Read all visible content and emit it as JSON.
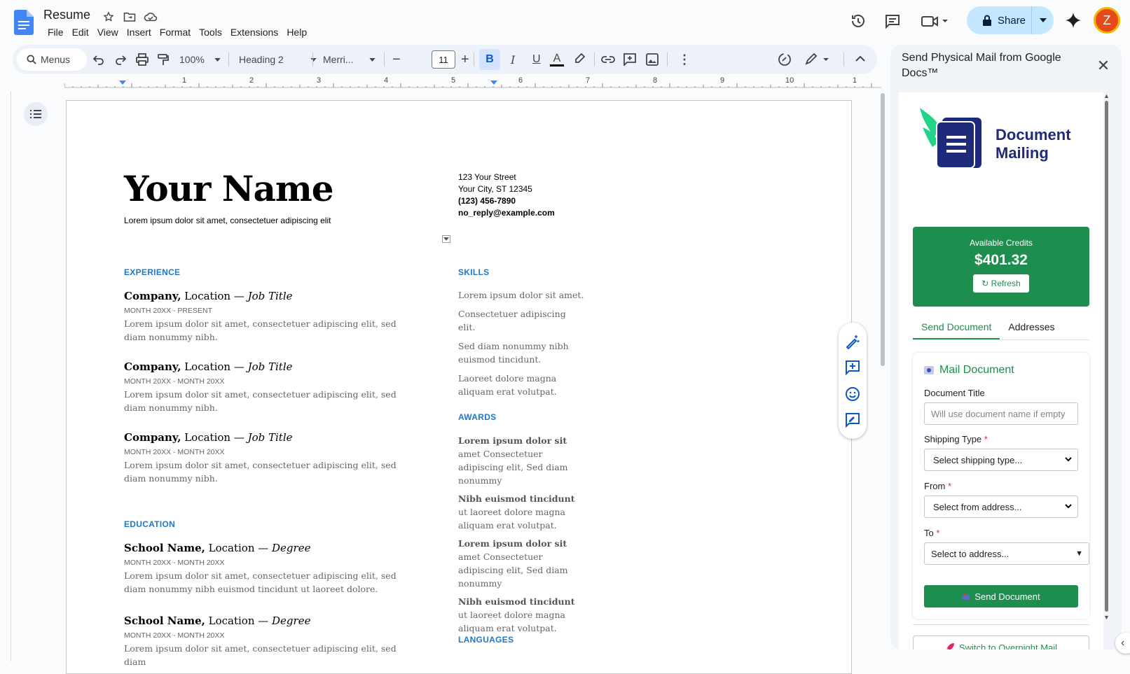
{
  "app": {
    "doc_title": "Resume",
    "menu": [
      "File",
      "Edit",
      "View",
      "Insert",
      "Format",
      "Tools",
      "Extensions",
      "Help"
    ],
    "share_label": "Share",
    "avatar_letter": "Z"
  },
  "toolbar": {
    "menus_label": "Menus",
    "zoom": "100%",
    "style": "Heading 2",
    "font": "Merri...",
    "font_size": "11",
    "bold": "B",
    "italic": "I",
    "underline": "U",
    "text_color": "A"
  },
  "ruler": {
    "marks": [
      "1",
      "2",
      "3",
      "4",
      "5",
      "6",
      "7",
      "8",
      "9",
      "10",
      "1"
    ]
  },
  "document": {
    "name": "Your Name",
    "tagline": "Lorem ipsum dolor sit amet, consectetuer adipiscing elit",
    "contact": {
      "street": "123 Your Street",
      "city": "Your City, ST 12345",
      "phone": "(123) 456-7890",
      "email": "no_reply@example.com"
    },
    "experience_heading": "EXPERIENCE",
    "jobs": [
      {
        "company": "Company,",
        "location": " Location — ",
        "title": "Job Title",
        "dates": "MONTH 20XX - PRESENT",
        "desc": "Lorem ipsum dolor sit amet, consectetuer adipiscing elit, sed diam nonummy nibh."
      },
      {
        "company": "Company,",
        "location": " Location — ",
        "title": "Job Title",
        "dates": "MONTH 20XX - MONTH 20XX",
        "desc": "Lorem ipsum dolor sit amet, consectetuer adipiscing elit, sed diam nonummy nibh."
      },
      {
        "company": "Company,",
        "location": " Location — ",
        "title": "Job Title",
        "dates": "MONTH 20XX - MONTH 20XX",
        "desc": "Lorem ipsum dolor sit amet, consectetuer adipiscing elit, sed diam nonummy nibh."
      }
    ],
    "education_heading": "EDUCATION",
    "schools": [
      {
        "company": "School Name,",
        "location": " Location — ",
        "title": "Degree",
        "dates": "MONTH 20XX - MONTH 20XX",
        "desc": "Lorem ipsum dolor sit amet, consectetuer adipiscing elit, sed diam nonummy nibh euismod tincidunt ut laoreet dolore."
      },
      {
        "company": "School Name,",
        "location": " Location — ",
        "title": "Degree",
        "dates": "MONTH 20XX - MONTH 20XX",
        "desc": "Lorem ipsum dolor sit amet, consectetuer adipiscing elit, sed diam"
      }
    ],
    "skills_heading": "SKILLS",
    "skills": [
      "Lorem ipsum dolor sit amet.",
      "Consectetuer adipiscing elit.",
      "Sed diam nonummy nibh euismod tincidunt.",
      "Laoreet dolore magna aliquam erat volutpat."
    ],
    "awards_heading": "AWARDS",
    "awards": [
      {
        "bold": "Lorem ipsum dolor sit",
        "rest": " amet Consectetuer adipiscing elit, Sed diam nonummy"
      },
      {
        "bold": "Nibh euismod tincidunt",
        "rest": " ut laoreet dolore magna aliquam erat volutpat."
      },
      {
        "bold": "Lorem ipsum dolor sit",
        "rest": " amet Consectetuer adipiscing elit, Sed diam nonummy"
      },
      {
        "bold": "Nibh euismod tincidunt",
        "rest": " ut laoreet dolore magna aliquam erat volutpat."
      }
    ],
    "languages_heading": "LANGUAGES"
  },
  "panel": {
    "title": "Send Physical Mail from Google Docs™",
    "logo_line1": "Document",
    "logo_line2": "Mailing",
    "credits_label": "Available Credits",
    "credits_value": "$401.32",
    "refresh_label": "↻ Refresh",
    "tabs": [
      "Send Document",
      "Addresses"
    ],
    "card_title": "Mail Document",
    "doc_title_label": "Document Title",
    "doc_title_placeholder": "Will use document name if empty",
    "shipping_label": "Shipping Type",
    "shipping_value": "Select shipping type...",
    "from_label": "From",
    "from_value": "Select from address...",
    "to_label": "To",
    "to_value": "Select to address...",
    "required_mark": "*",
    "send_label": "Send Document",
    "overnight_label": "Switch to Overnight Mail"
  },
  "colors": {
    "accent_green": "#1e8e4e",
    "heading_blue": "#2079c7",
    "share_bg": "#c2e7ff"
  }
}
